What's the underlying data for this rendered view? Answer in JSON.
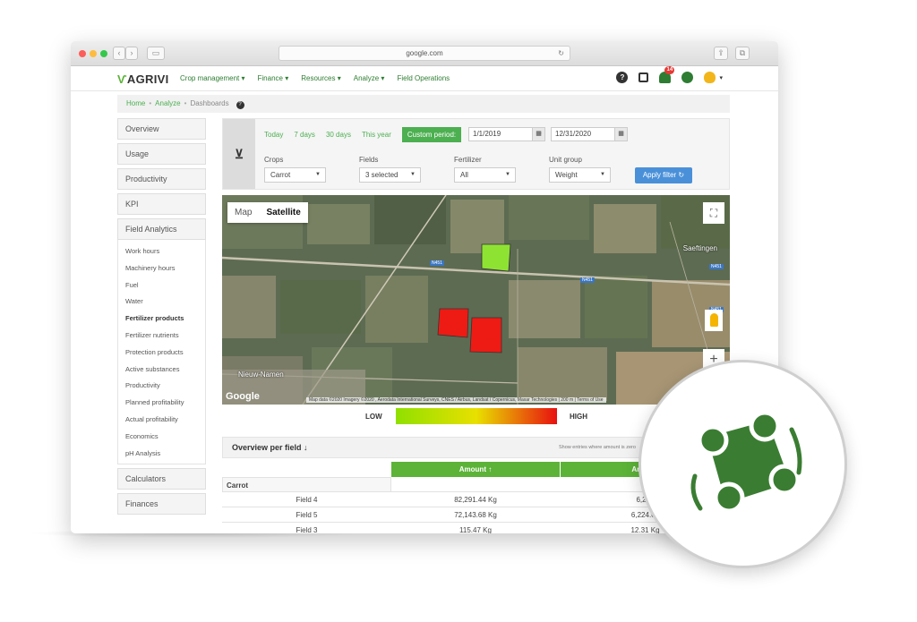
{
  "browser": {
    "url": "google.com"
  },
  "app": {
    "logo": "AGRIVI",
    "nav": [
      "Crop management",
      "Finance",
      "Resources",
      "Analyze",
      "Field Operations"
    ],
    "notification_count": "14"
  },
  "breadcrumb": {
    "home": "Home",
    "analyze": "Analyze",
    "current": "Dashboards"
  },
  "sidebar": {
    "sections": [
      "Overview",
      "Usage",
      "Productivity",
      "KPI",
      "Field Analytics"
    ],
    "field_analytics_items": [
      "Work hours",
      "Machinery hours",
      "Fuel",
      "Water",
      "Fertilizer products",
      "Fertilizer nutrients",
      "Protection products",
      "Active substances",
      "Productivity",
      "Planned profitability",
      "Actual profitability",
      "Economics",
      "pH Analysis"
    ],
    "active_item": "Fertilizer products",
    "bottom_sections": [
      "Calculators",
      "Finances"
    ]
  },
  "filter": {
    "periods": [
      "Today",
      "7 days",
      "30 days",
      "This year"
    ],
    "custom_period": "Custom period:",
    "date_from": "1/1/2019",
    "date_to": "12/31/2020",
    "labels": {
      "crops": "Crops",
      "fields": "Fields",
      "fertilizer": "Fertilizer",
      "unit_group": "Unit group"
    },
    "values": {
      "crops": "Carrot",
      "fields": "3 selected",
      "fertilizer": "All",
      "unit_group": "Weight"
    },
    "apply_label": "Apply filter"
  },
  "map": {
    "tabs": {
      "map": "Map",
      "satellite": "Satellite"
    },
    "place_names": {
      "saeftingen": "Saeftingen",
      "nieuw_namen": "Nieuw-Namen"
    },
    "road_label": "N451",
    "google": "Google",
    "attribution": "Map data ©2020 Imagery ©2020 , Aerodata International Surveys, CNES / Airbus, Landsat / Copernicus, Maxar Technologies | 200 m | Terms of Use",
    "legend": {
      "low": "LOW",
      "high": "HIGH"
    }
  },
  "overview": {
    "title": "Overview per field",
    "note": "Show entries where amount is zero",
    "columns": [
      "Amount",
      "Amount"
    ],
    "group": "Carrot",
    "rows": [
      {
        "field": "Field 4",
        "amount": "82,291.44 Kg",
        "amount2": "6,224"
      },
      {
        "field": "Field 5",
        "amount": "72,143.68 Kg",
        "amount2": "6,224.65"
      },
      {
        "field": "Field 3",
        "amount": "115.47 Kg",
        "amount2": "12.31 Kg"
      }
    ]
  },
  "colors": {
    "brand_green": "#5cb338",
    "link_green": "#4caf50",
    "badge_green": "#3a7d32",
    "apply_blue": "#4a90d9"
  }
}
